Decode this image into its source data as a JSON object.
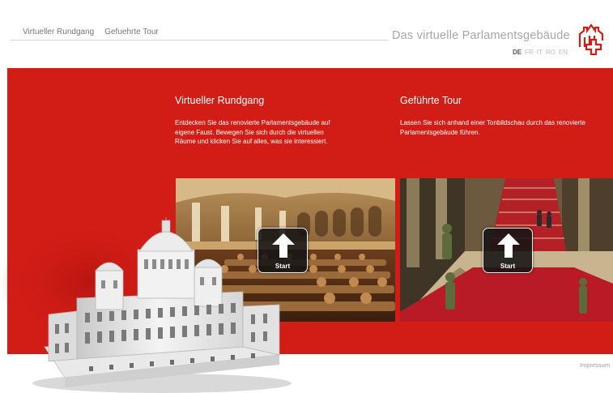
{
  "header": {
    "nav": [
      {
        "label": "Virtueller Rundgang"
      },
      {
        "label": "Gefuehrte Tour"
      }
    ],
    "site_title": "Das virtuelle Parlamentsgebäude",
    "languages": [
      {
        "code": "DE",
        "active": true
      },
      {
        "code": "FR",
        "active": false
      },
      {
        "code": "IT",
        "active": false
      },
      {
        "code": "RO",
        "active": false
      },
      {
        "code": "EN",
        "active": false
      }
    ]
  },
  "panels": [
    {
      "title": "Virtueller Rundgang",
      "description": "Entdecken Sie das renovierte Parlamentsgebäude auf eigene Faust. Bewegen Sie sich durch die virtuellen Räume und klicken Sie auf alles, was sie interessiert.",
      "button_label": "Start"
    },
    {
      "title": "Geführte Tour",
      "description": "Lassen Sie sich anhand einer Tonbildschau durch das renovierte Parlamentsgebäude führen.",
      "button_label": "Start"
    }
  ],
  "footer": {
    "link": "Impressum"
  },
  "colors": {
    "brand_red": "#d21d16",
    "text_grey": "#a6a6a6",
    "button_bg": "#141414"
  }
}
